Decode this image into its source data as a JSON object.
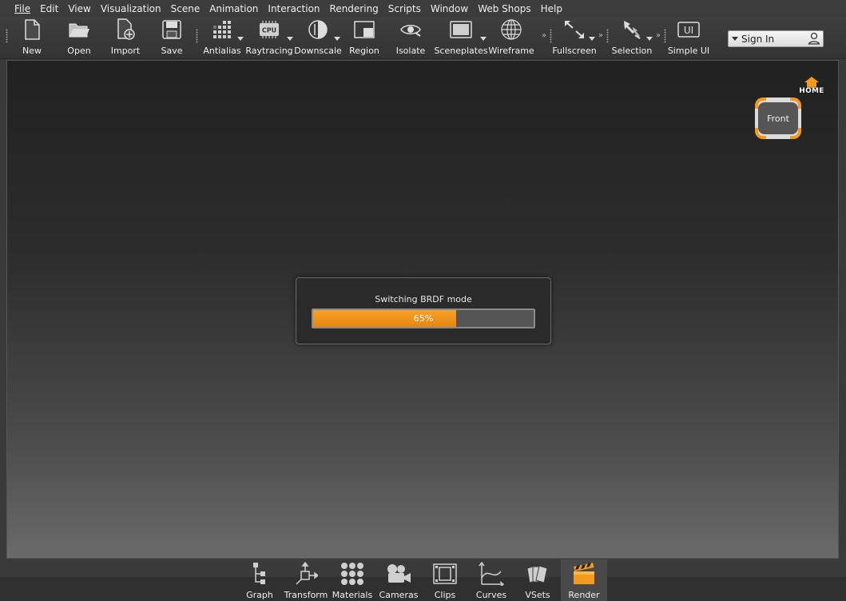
{
  "menu": [
    "File",
    "Edit",
    "View",
    "Visualization",
    "Scene",
    "Animation",
    "Interaction",
    "Rendering",
    "Scripts",
    "Window",
    "Web Shops",
    "Help"
  ],
  "toolbar": {
    "new": "New",
    "open": "Open",
    "import": "Import",
    "save": "Save",
    "antialias": "Antialias",
    "raytracing": "Raytracing",
    "raytracing_badge": "CPU",
    "downscale": "Downscale",
    "region": "Region",
    "isolate": "Isolate",
    "sceneplates": "Sceneplates",
    "wireframe": "Wireframe",
    "fullscreen": "Fullscreen",
    "selection": "Selection",
    "simple_ui": "Simple UI",
    "simple_ui_badge": "UI"
  },
  "signin": {
    "label": "Sign In"
  },
  "viewport": {
    "home_label": "HOME",
    "viewcube_face": "Front",
    "accent": "#f39a1f"
  },
  "progress": {
    "title": "Switching BRDF mode",
    "percent_text": "65%",
    "value": 0.65,
    "fill_color": "#f39a1f"
  },
  "dock": {
    "graph": "Graph",
    "transform": "Transform",
    "materials": "Materials",
    "cameras": "Cameras",
    "clips": "Clips",
    "curves": "Curves",
    "vsets": "VSets",
    "render": "Render",
    "active": "render"
  }
}
